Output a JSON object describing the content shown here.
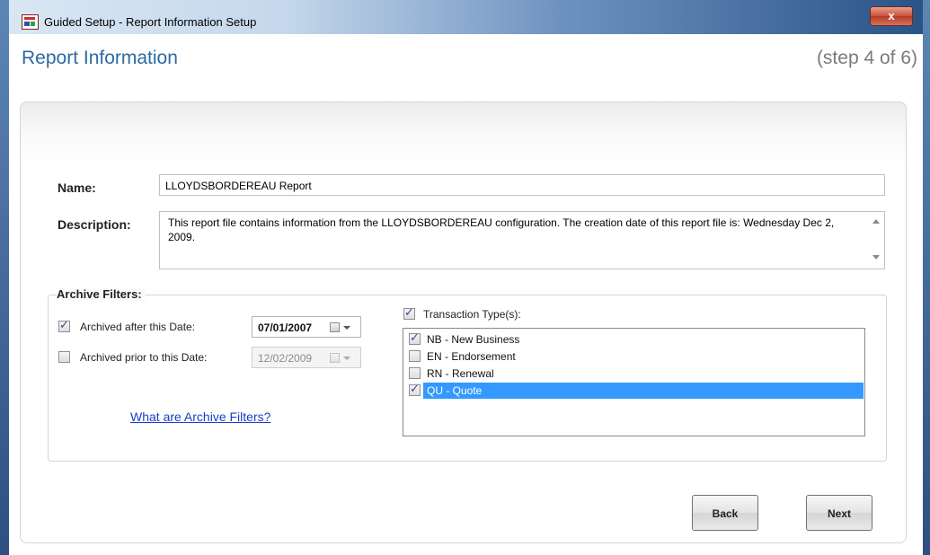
{
  "window": {
    "title": "Guided Setup - Report Information Setup",
    "close_label": "x"
  },
  "header": {
    "title": "Report Information",
    "step": "(step 4 of 6)"
  },
  "form": {
    "name_label": "Name:",
    "name_value": "LLOYDSBORDEREAU Report",
    "description_label": "Description:",
    "description_value": "This report file contains information from the LLOYDSBORDEREAU configuration.  The creation date of this report file is: Wednesday Dec 2, 2009."
  },
  "archive_filters": {
    "title": "Archive Filters:",
    "after": {
      "label": "Archived after this Date:",
      "checked": true,
      "date": "07/01/2007",
      "enabled": true
    },
    "prior": {
      "label": "Archived prior to this Date:",
      "checked": false,
      "date": "12/02/2009",
      "enabled": false
    },
    "help_link": "What are Archive Filters?",
    "transaction_types": {
      "label": "Transaction Type(s):",
      "checked": true,
      "items": [
        {
          "label": "NB - New Business",
          "checked": true,
          "selected": false
        },
        {
          "label": "EN - Endorsement",
          "checked": false,
          "selected": false
        },
        {
          "label": "RN - Renewal",
          "checked": false,
          "selected": false
        },
        {
          "label": "QU - Quote",
          "checked": true,
          "selected": true
        }
      ]
    }
  },
  "footer": {
    "back_label": "Back",
    "next_label": "Next"
  },
  "colors": {
    "heading": "#2b6aa3",
    "selection": "#3399ff",
    "link": "#1a3fc7"
  }
}
